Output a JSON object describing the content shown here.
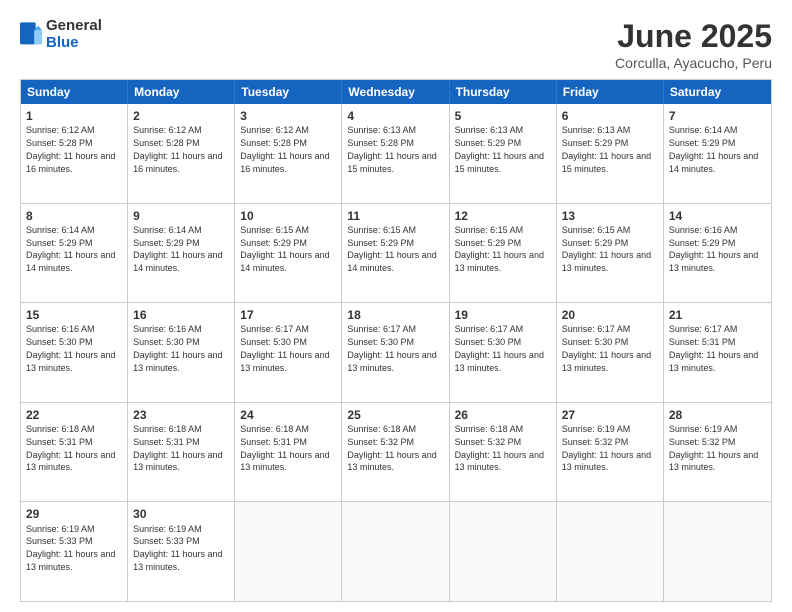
{
  "header": {
    "logo": {
      "general": "General",
      "blue": "Blue"
    },
    "title": "June 2025",
    "subtitle": "Corculla, Ayacucho, Peru"
  },
  "calendar": {
    "days": [
      "Sunday",
      "Monday",
      "Tuesday",
      "Wednesday",
      "Thursday",
      "Friday",
      "Saturday"
    ],
    "rows": [
      [
        {
          "day": "1",
          "info": "Sunrise: 6:12 AM\nSunset: 5:28 PM\nDaylight: 11 hours and 16 minutes."
        },
        {
          "day": "2",
          "info": "Sunrise: 6:12 AM\nSunset: 5:28 PM\nDaylight: 11 hours and 16 minutes."
        },
        {
          "day": "3",
          "info": "Sunrise: 6:12 AM\nSunset: 5:28 PM\nDaylight: 11 hours and 16 minutes."
        },
        {
          "day": "4",
          "info": "Sunrise: 6:13 AM\nSunset: 5:28 PM\nDaylight: 11 hours and 15 minutes."
        },
        {
          "day": "5",
          "info": "Sunrise: 6:13 AM\nSunset: 5:29 PM\nDaylight: 11 hours and 15 minutes."
        },
        {
          "day": "6",
          "info": "Sunrise: 6:13 AM\nSunset: 5:29 PM\nDaylight: 11 hours and 15 minutes."
        },
        {
          "day": "7",
          "info": "Sunrise: 6:14 AM\nSunset: 5:29 PM\nDaylight: 11 hours and 14 minutes."
        }
      ],
      [
        {
          "day": "8",
          "info": "Sunrise: 6:14 AM\nSunset: 5:29 PM\nDaylight: 11 hours and 14 minutes."
        },
        {
          "day": "9",
          "info": "Sunrise: 6:14 AM\nSunset: 5:29 PM\nDaylight: 11 hours and 14 minutes."
        },
        {
          "day": "10",
          "info": "Sunrise: 6:15 AM\nSunset: 5:29 PM\nDaylight: 11 hours and 14 minutes."
        },
        {
          "day": "11",
          "info": "Sunrise: 6:15 AM\nSunset: 5:29 PM\nDaylight: 11 hours and 14 minutes."
        },
        {
          "day": "12",
          "info": "Sunrise: 6:15 AM\nSunset: 5:29 PM\nDaylight: 11 hours and 13 minutes."
        },
        {
          "day": "13",
          "info": "Sunrise: 6:15 AM\nSunset: 5:29 PM\nDaylight: 11 hours and 13 minutes."
        },
        {
          "day": "14",
          "info": "Sunrise: 6:16 AM\nSunset: 5:29 PM\nDaylight: 11 hours and 13 minutes."
        }
      ],
      [
        {
          "day": "15",
          "info": "Sunrise: 6:16 AM\nSunset: 5:30 PM\nDaylight: 11 hours and 13 minutes."
        },
        {
          "day": "16",
          "info": "Sunrise: 6:16 AM\nSunset: 5:30 PM\nDaylight: 11 hours and 13 minutes."
        },
        {
          "day": "17",
          "info": "Sunrise: 6:17 AM\nSunset: 5:30 PM\nDaylight: 11 hours and 13 minutes."
        },
        {
          "day": "18",
          "info": "Sunrise: 6:17 AM\nSunset: 5:30 PM\nDaylight: 11 hours and 13 minutes."
        },
        {
          "day": "19",
          "info": "Sunrise: 6:17 AM\nSunset: 5:30 PM\nDaylight: 11 hours and 13 minutes."
        },
        {
          "day": "20",
          "info": "Sunrise: 6:17 AM\nSunset: 5:30 PM\nDaylight: 11 hours and 13 minutes."
        },
        {
          "day": "21",
          "info": "Sunrise: 6:17 AM\nSunset: 5:31 PM\nDaylight: 11 hours and 13 minutes."
        }
      ],
      [
        {
          "day": "22",
          "info": "Sunrise: 6:18 AM\nSunset: 5:31 PM\nDaylight: 11 hours and 13 minutes."
        },
        {
          "day": "23",
          "info": "Sunrise: 6:18 AM\nSunset: 5:31 PM\nDaylight: 11 hours and 13 minutes."
        },
        {
          "day": "24",
          "info": "Sunrise: 6:18 AM\nSunset: 5:31 PM\nDaylight: 11 hours and 13 minutes."
        },
        {
          "day": "25",
          "info": "Sunrise: 6:18 AM\nSunset: 5:32 PM\nDaylight: 11 hours and 13 minutes."
        },
        {
          "day": "26",
          "info": "Sunrise: 6:18 AM\nSunset: 5:32 PM\nDaylight: 11 hours and 13 minutes."
        },
        {
          "day": "27",
          "info": "Sunrise: 6:19 AM\nSunset: 5:32 PM\nDaylight: 11 hours and 13 minutes."
        },
        {
          "day": "28",
          "info": "Sunrise: 6:19 AM\nSunset: 5:32 PM\nDaylight: 11 hours and 13 minutes."
        }
      ],
      [
        {
          "day": "29",
          "info": "Sunrise: 6:19 AM\nSunset: 5:33 PM\nDaylight: 11 hours and 13 minutes."
        },
        {
          "day": "30",
          "info": "Sunrise: 6:19 AM\nSunset: 5:33 PM\nDaylight: 11 hours and 13 minutes."
        },
        {
          "day": "",
          "info": ""
        },
        {
          "day": "",
          "info": ""
        },
        {
          "day": "",
          "info": ""
        },
        {
          "day": "",
          "info": ""
        },
        {
          "day": "",
          "info": ""
        }
      ]
    ]
  }
}
